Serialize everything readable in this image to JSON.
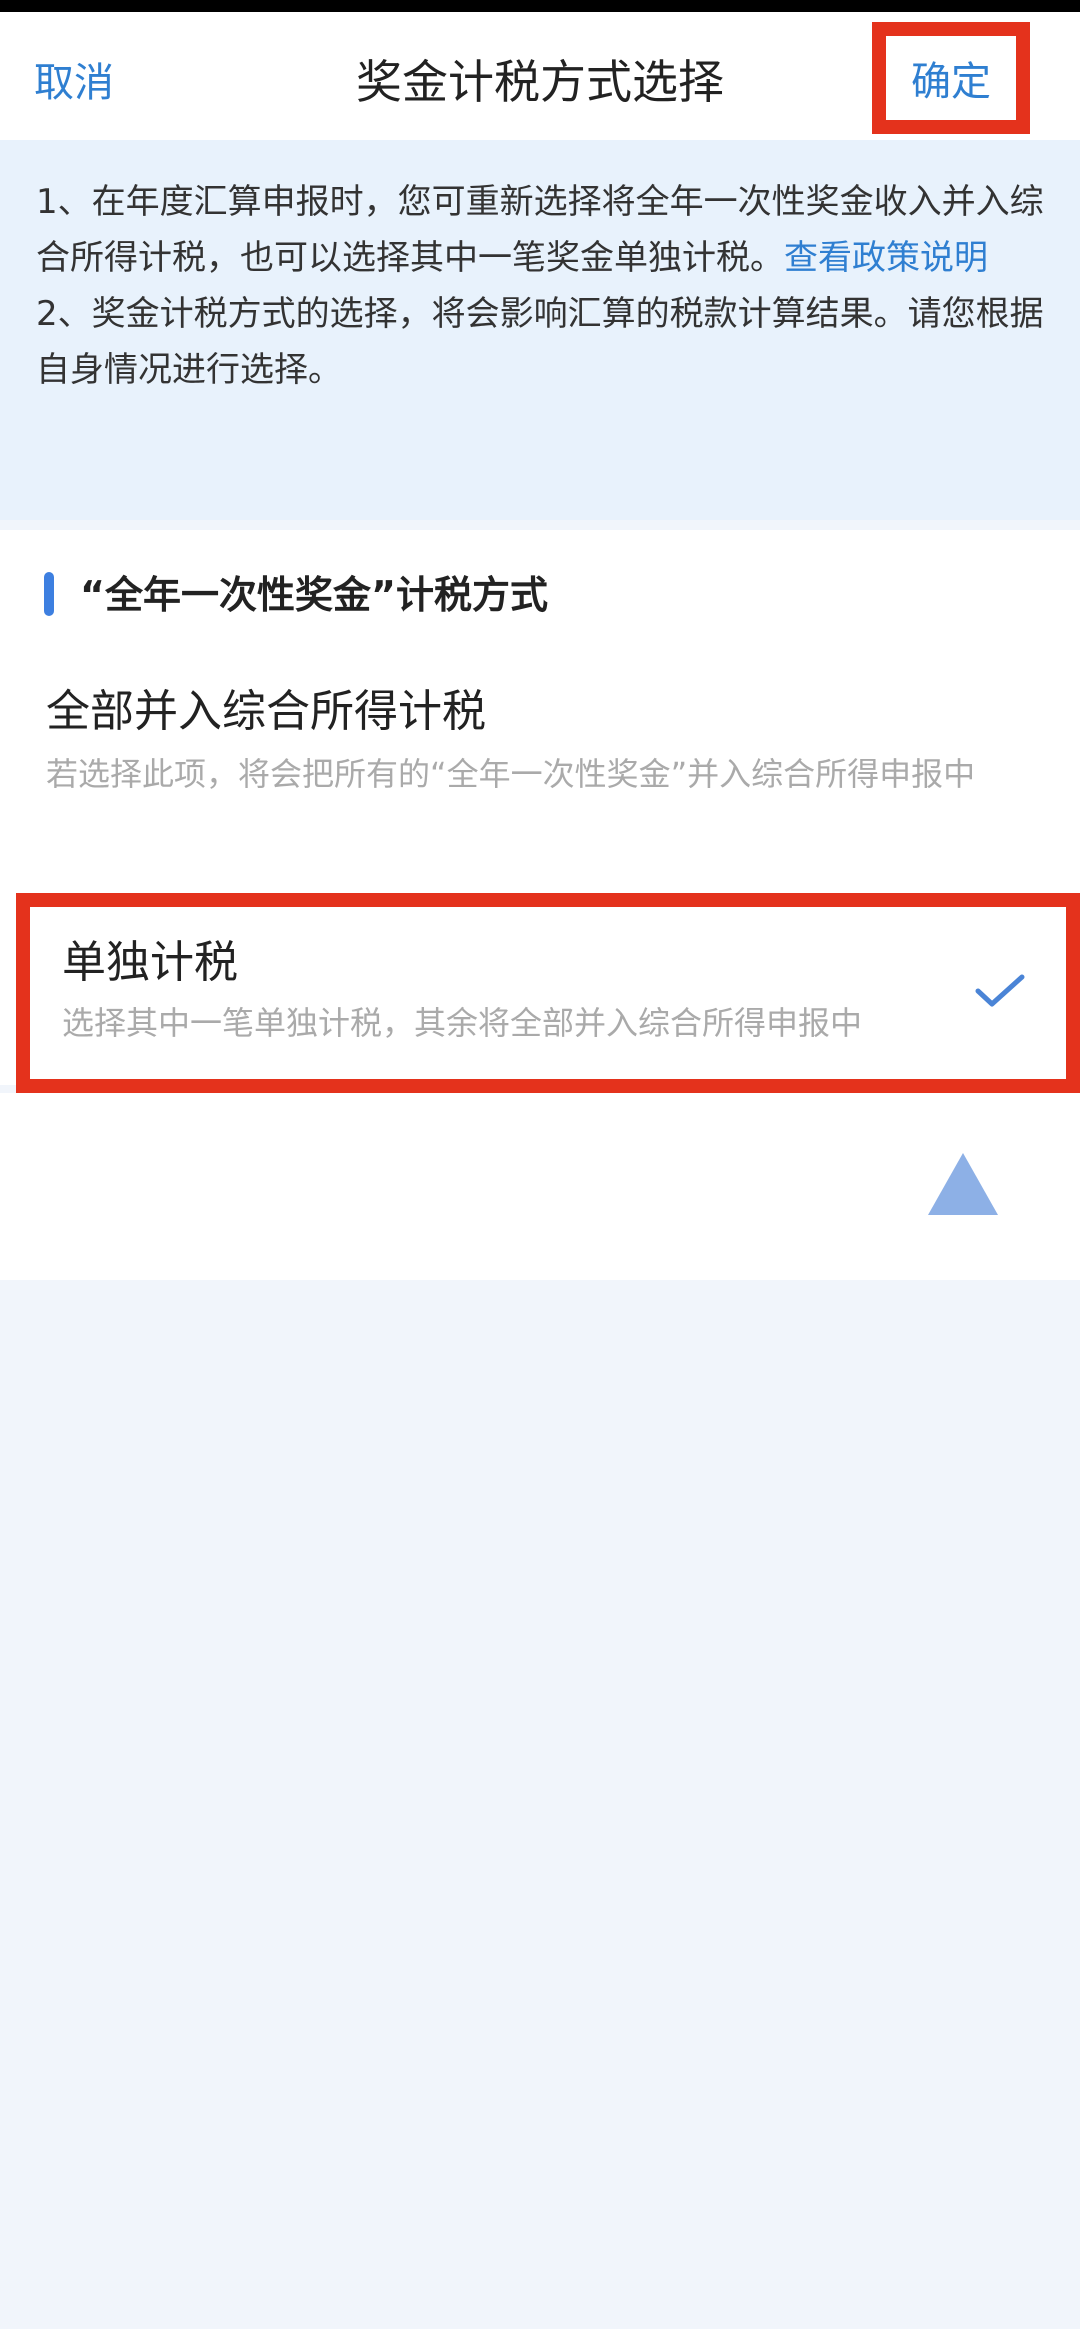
{
  "nav": {
    "cancel_label": "取消",
    "title": "奖金计税方式选择",
    "confirm_label": "确定"
  },
  "notice": {
    "line1_text": "1、在年度汇算申报时，您可重新选择将全年一次性奖金收入并入综合所得计税，也可以选择其中一笔奖金单独计税。",
    "policy_link": "查看政策说明",
    "line2_text": "2、奖金计税方式的选择，将会影响汇算的税款计算结果。请您根据自身情况进行选择。"
  },
  "section": {
    "title": "“全年一次性奖金”计税方式"
  },
  "options": [
    {
      "title": "全部并入综合所得计税",
      "description": "若选择此项，将会把所有的“全年一次性奖金”并入综合所得申报中",
      "selected": false
    },
    {
      "title": "单独计税",
      "description": "选择其中一笔单独计税，其余将全部并入综合所得申报中",
      "selected": true
    }
  ],
  "icons": {
    "selected_check": "check-icon",
    "scroll_top": "up-triangle-icon"
  },
  "colors": {
    "accent_blue": "#2f7fd1",
    "highlight_red": "#e4321c",
    "notice_bg": "#e8f2fc",
    "page_bg": "#f1f5fb"
  }
}
